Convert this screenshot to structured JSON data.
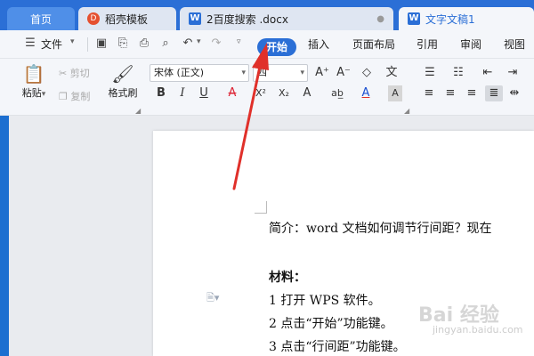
{
  "tabs": [
    {
      "label": "首页"
    },
    {
      "label": "稻壳模板"
    },
    {
      "label": "2百度搜索 .docx"
    },
    {
      "label": "文字文稿1"
    }
  ],
  "menu": {
    "file": "文件",
    "items": [
      "开始",
      "插入",
      "页面布局",
      "引用",
      "审阅",
      "视图"
    ]
  },
  "ribbon": {
    "paste": "粘贴",
    "cut": "剪切",
    "copy": "复制",
    "format_painter": "格式刷",
    "font_name": "宋体 (正文)",
    "font_size": "四",
    "font_grow": "A⁺",
    "font_shrink": "A⁻",
    "clear_format": "◇",
    "pinyin": "文",
    "bold": "B",
    "italic": "I",
    "underline": "U",
    "strike": "A",
    "superscript": "X²",
    "subscript": "X₂",
    "text_effect": "A",
    "highlight": "ab̲",
    "font_color": "A",
    "char_shading": "A"
  },
  "document": {
    "lines": [
      {
        "text": "简介：word 文档如何调节行间距？现在",
        "bold": false
      },
      {
        "text": "材料：",
        "bold": true
      },
      {
        "text": "1  打开 WPS 软件。",
        "bold": false
      },
      {
        "text": "2 点击“开始”功能键。",
        "bold": false
      },
      {
        "text": "3 点击“行间距”功能键。",
        "bold": false
      }
    ]
  },
  "watermark": {
    "text": "Bai 经验",
    "sub": "jingyan.baidu.com"
  },
  "colors": {
    "accent": "#2b6fd6",
    "arrow": "#e0302a"
  }
}
